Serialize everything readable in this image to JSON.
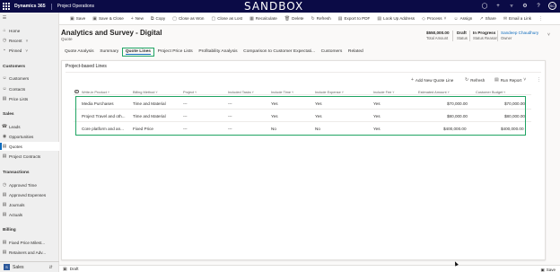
{
  "topbar": {
    "app_name": "Dynamics 365",
    "area_name": "Project Operations",
    "sandbox_label": "SANDBOX",
    "icons": [
      "lightbulb-icon",
      "plus-icon",
      "filter-icon",
      "gear-icon",
      "help-icon",
      "avatar"
    ],
    "avatar_initials": "SC"
  },
  "commandbar": {
    "items": [
      {
        "icon": "save-icon",
        "label": "Save"
      },
      {
        "icon": "save-close-icon",
        "label": "Save & Close"
      },
      {
        "icon": "plus-icon",
        "label": "New"
      },
      {
        "icon": "copy-icon",
        "label": "Copy"
      },
      {
        "icon": "close-won-icon",
        "label": "Close as Won"
      },
      {
        "icon": "close-lost-icon",
        "label": "Close as Lost"
      },
      {
        "icon": "recalculate-icon",
        "label": "Recalculate"
      },
      {
        "icon": "delete-icon",
        "label": "Delete"
      },
      {
        "icon": "refresh-icon",
        "label": "Refresh"
      },
      {
        "icon": "export-pdf-icon",
        "label": "Export to PDF"
      },
      {
        "icon": "lookup-address-icon",
        "label": "Look Up Address"
      },
      {
        "icon": "process-icon",
        "label": "Process"
      },
      {
        "icon": "assign-icon",
        "label": "Assign"
      },
      {
        "icon": "share-icon",
        "label": "Share"
      },
      {
        "icon": "email-link-icon",
        "label": "Email a Link"
      }
    ]
  },
  "leftnav": {
    "top": [
      {
        "icon": "home-icon",
        "label": "Home"
      },
      {
        "icon": "clock-icon",
        "label": "Recent"
      },
      {
        "icon": "pin-icon",
        "label": "Pinned"
      }
    ],
    "groups": [
      {
        "title": "Customers",
        "items": [
          {
            "icon": "person-icon",
            "label": "Customers"
          },
          {
            "icon": "contact-icon",
            "label": "Contacts"
          },
          {
            "icon": "price-list-icon",
            "label": "Price Lists"
          }
        ]
      },
      {
        "title": "Sales",
        "items": [
          {
            "icon": "lead-icon",
            "label": "Leads"
          },
          {
            "icon": "opportunity-icon",
            "label": "Opportunities"
          },
          {
            "icon": "quote-icon",
            "label": "Quotes"
          },
          {
            "icon": "contract-icon",
            "label": "Project Contracts"
          }
        ]
      },
      {
        "title": "Transactions",
        "items": [
          {
            "icon": "time-icon",
            "label": "Approved Time"
          },
          {
            "icon": "expense-icon",
            "label": "Approved Expenses"
          },
          {
            "icon": "journal-icon",
            "label": "Journals"
          },
          {
            "icon": "actuals-icon",
            "label": "Actuals"
          }
        ]
      },
      {
        "title": "Billing",
        "items": [
          {
            "icon": "milestone-icon",
            "label": "Fixed Price Milest..."
          },
          {
            "icon": "retainer-icon",
            "label": "Retainers and Adv..."
          }
        ]
      }
    ],
    "area_switcher": {
      "badge": "S",
      "label": "Sales"
    }
  },
  "record": {
    "title": "Analytics and Survey - Digital",
    "entity": "Quote",
    "header_fields": [
      {
        "value": "$550,000.00",
        "label": "Total Amount"
      },
      {
        "value": "Draft",
        "label": "Status"
      },
      {
        "value": "In Progress",
        "label": "Status Reason"
      },
      {
        "value": "Sandeep Chaudhury",
        "label": "Owner"
      }
    ]
  },
  "tabs": [
    "Quote Analysis",
    "Summary",
    "Quote Lines",
    "Project Price Lists",
    "Profitability Analysis",
    "Comparison to Customer Expectati...",
    "Customers",
    "Related"
  ],
  "active_tab": "Quote Lines",
  "section": {
    "title": "Project-based Lines",
    "commands": [
      "Add New Quote Line",
      "Refresh",
      "Run Report"
    ]
  },
  "grid": {
    "columns": [
      "Write-in Product",
      "Billing Method",
      "Project",
      "Included Tasks",
      "Include Time",
      "Include Expense",
      "Include Fee",
      "Estimated Amount",
      "Customer Budget"
    ],
    "rows": [
      [
        "Media Purchases",
        "Time and Material",
        "---",
        "---",
        "Yes",
        "Yes",
        "Yes",
        "$70,000.00",
        "$70,000.00"
      ],
      [
        "Project Travel and oth...",
        "Time and Material",
        "---",
        "---",
        "Yes",
        "Yes",
        "Yes",
        "$80,000.00",
        "$80,000.00"
      ],
      [
        "Core platform and an...",
        "Fixed Price",
        "---",
        "---",
        "No",
        "No",
        "Yes",
        "$400,000.00",
        "$400,000.00"
      ]
    ]
  },
  "statusbar": {
    "status": "Draft",
    "save_label": "Save"
  },
  "colors": {
    "nav": "#0b0b46",
    "highlight": "#1fa463",
    "accent": "#0f6cbd"
  }
}
